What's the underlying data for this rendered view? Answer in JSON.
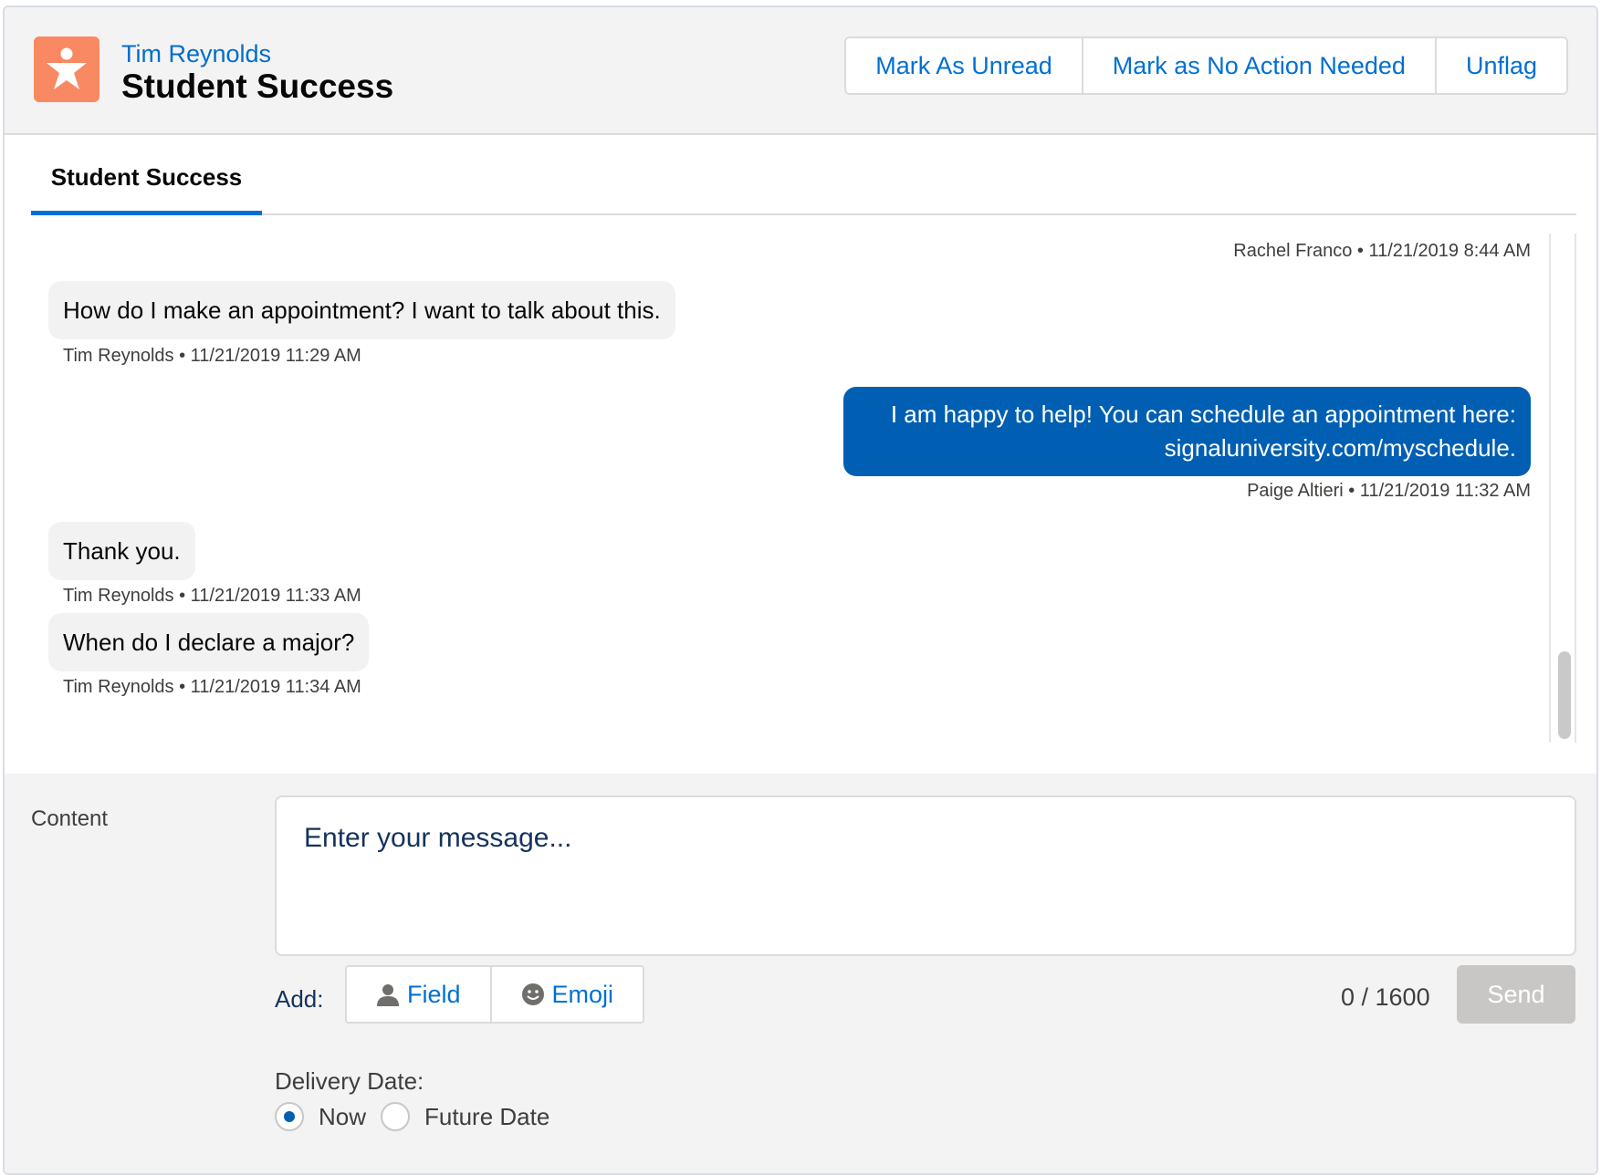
{
  "header": {
    "owner": "Tim Reynolds",
    "title": "Student Success",
    "icon": "person-star-icon",
    "actions": {
      "mark_unread": "Mark As Unread",
      "mark_no_action": "Mark as No Action Needed",
      "unflag": "Unflag"
    }
  },
  "tabs": {
    "active": "Student Success"
  },
  "conversation": {
    "messages": [
      {
        "direction": "meta-only",
        "author": "Rachel Franco",
        "time": "11/21/2019 8:44 AM",
        "meta": "Rachel Franco • 11/21/2019 8:44 AM"
      },
      {
        "direction": "in",
        "lines": [
          "How do I make an appointment? I want to talk about this."
        ],
        "meta": "Tim Reynolds • 11/21/2019 11:29 AM"
      },
      {
        "direction": "out",
        "lines": [
          "I am happy to help! You can schedule an appointment here:",
          "signaluniversity.com/myschedule."
        ],
        "meta": "Paige Altieri • 11/21/2019 11:32 AM"
      },
      {
        "direction": "in",
        "lines": [
          "Thank you."
        ],
        "meta": "Tim Reynolds • 11/21/2019 11:33 AM"
      },
      {
        "direction": "in",
        "lines": [
          "When do I declare a major?"
        ],
        "meta": "Tim Reynolds • 11/21/2019 11:34 AM"
      }
    ]
  },
  "composer": {
    "content_label": "Content",
    "placeholder": "Enter your message...",
    "add_label": "Add:",
    "field_label": "Field",
    "emoji_label": "Emoji",
    "counter": "0 / 1600",
    "send_label": "Send",
    "delivery_label": "Delivery Date:",
    "option_now": "Now",
    "option_future": "Future Date",
    "selected": "Now"
  },
  "colors": {
    "accent": "#0070d2",
    "outgoing_bubble": "#005fb2",
    "app_icon": "#f88962"
  }
}
